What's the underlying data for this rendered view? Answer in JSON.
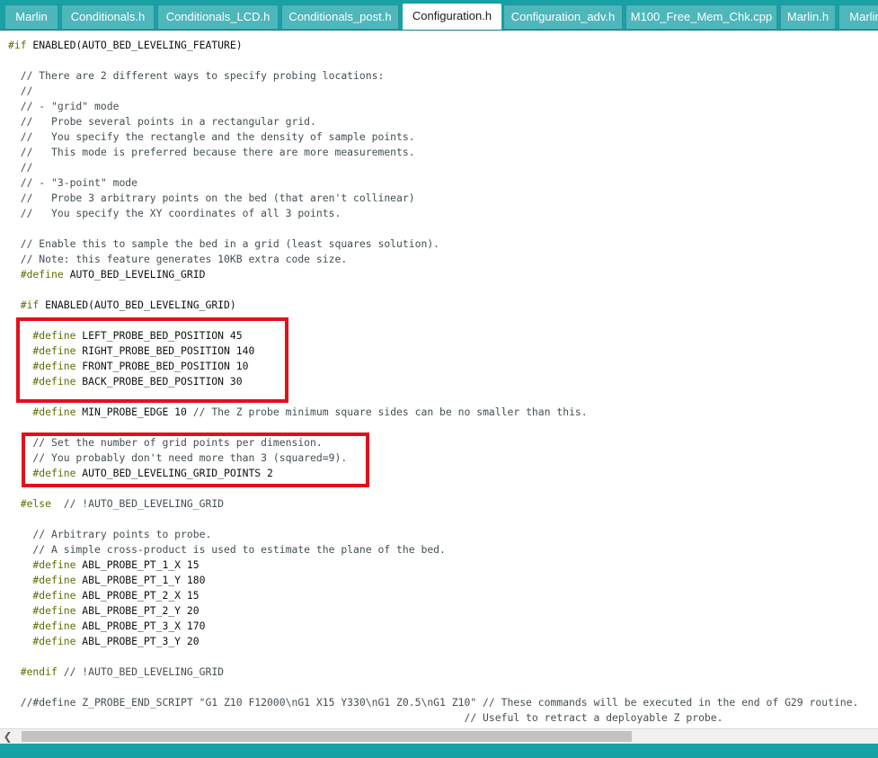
{
  "tabs": [
    {
      "label": "Marlin",
      "active": false
    },
    {
      "label": "Conditionals.h",
      "active": false
    },
    {
      "label": "Conditionals_LCD.h",
      "active": false
    },
    {
      "label": "Conditionals_post.h",
      "active": false
    },
    {
      "label": "Configuration.h",
      "active": true
    },
    {
      "label": "Configuration_adv.h",
      "active": false
    },
    {
      "label": "M100_Free_Mem_Chk.cpp",
      "active": false
    },
    {
      "label": "Marlin.h",
      "active": false
    },
    {
      "label": "Marlin",
      "active": false
    }
  ],
  "colors": {
    "accent": "#17a1a5",
    "preprocessor": "#5e6d03",
    "comment": "#434f54",
    "highlight": "#e3101b"
  },
  "icons": {
    "scroll_left": "chevron-left-icon"
  },
  "code_lines": [
    [
      {
        "k": "pp",
        "t": "#if"
      },
      {
        "k": "tx",
        "t": " ENABLED(AUTO_BED_LEVELING_FEATURE)"
      }
    ],
    [],
    [
      {
        "k": "cm",
        "t": "  // There are 2 different ways to specify probing locations:"
      }
    ],
    [
      {
        "k": "cm",
        "t": "  //"
      }
    ],
    [
      {
        "k": "cm",
        "t": "  // - \"grid\" mode"
      }
    ],
    [
      {
        "k": "cm",
        "t": "  //   Probe several points in a rectangular grid."
      }
    ],
    [
      {
        "k": "cm",
        "t": "  //   You specify the rectangle and the density of sample points."
      }
    ],
    [
      {
        "k": "cm",
        "t": "  //   This mode is preferred because there are more measurements."
      }
    ],
    [
      {
        "k": "cm",
        "t": "  //"
      }
    ],
    [
      {
        "k": "cm",
        "t": "  // - \"3-point\" mode"
      }
    ],
    [
      {
        "k": "cm",
        "t": "  //   Probe 3 arbitrary points on the bed (that aren't collinear)"
      }
    ],
    [
      {
        "k": "cm",
        "t": "  //   You specify the XY coordinates of all 3 points."
      }
    ],
    [],
    [
      {
        "k": "cm",
        "t": "  // Enable this to sample the bed in a grid (least squares solution)."
      }
    ],
    [
      {
        "k": "cm",
        "t": "  // Note: this feature generates 10KB extra code size."
      }
    ],
    [
      {
        "k": "pp",
        "t": "  #define"
      },
      {
        "k": "tx",
        "t": " AUTO_BED_LEVELING_GRID"
      }
    ],
    [],
    [
      {
        "k": "pp",
        "t": "  #if"
      },
      {
        "k": "tx",
        "t": " ENABLED(AUTO_BED_LEVELING_GRID)"
      }
    ],
    [],
    [
      {
        "k": "pp",
        "t": "    #define"
      },
      {
        "k": "tx",
        "t": " LEFT_PROBE_BED_POSITION 45"
      }
    ],
    [
      {
        "k": "pp",
        "t": "    #define"
      },
      {
        "k": "tx",
        "t": " RIGHT_PROBE_BED_POSITION 140"
      }
    ],
    [
      {
        "k": "pp",
        "t": "    #define"
      },
      {
        "k": "tx",
        "t": " FRONT_PROBE_BED_POSITION 10"
      }
    ],
    [
      {
        "k": "pp",
        "t": "    #define"
      },
      {
        "k": "tx",
        "t": " BACK_PROBE_BED_POSITION 30"
      }
    ],
    [],
    [
      {
        "k": "pp",
        "t": "    #define"
      },
      {
        "k": "tx",
        "t": " MIN_PROBE_EDGE 10 "
      },
      {
        "k": "cm",
        "t": "// The Z probe minimum square sides can be no smaller than this."
      }
    ],
    [],
    [
      {
        "k": "cm",
        "t": "    // Set the number of grid points per dimension."
      }
    ],
    [
      {
        "k": "cm",
        "t": "    // You probably don't need more than 3 (squared=9)."
      }
    ],
    [
      {
        "k": "pp",
        "t": "    #define"
      },
      {
        "k": "tx",
        "t": " AUTO_BED_LEVELING_GRID_POINTS 2"
      }
    ],
    [],
    [
      {
        "k": "pp",
        "t": "  #else"
      },
      {
        "k": "cm",
        "t": "  // !AUTO_BED_LEVELING_GRID"
      }
    ],
    [],
    [
      {
        "k": "cm",
        "t": "    // Arbitrary points to probe."
      }
    ],
    [
      {
        "k": "cm",
        "t": "    // A simple cross-product is used to estimate the plane of the bed."
      }
    ],
    [
      {
        "k": "pp",
        "t": "    #define"
      },
      {
        "k": "tx",
        "t": " ABL_PROBE_PT_1_X 15"
      }
    ],
    [
      {
        "k": "pp",
        "t": "    #define"
      },
      {
        "k": "tx",
        "t": " ABL_PROBE_PT_1_Y 180"
      }
    ],
    [
      {
        "k": "pp",
        "t": "    #define"
      },
      {
        "k": "tx",
        "t": " ABL_PROBE_PT_2_X 15"
      }
    ],
    [
      {
        "k": "pp",
        "t": "    #define"
      },
      {
        "k": "tx",
        "t": " ABL_PROBE_PT_2_Y 20"
      }
    ],
    [
      {
        "k": "pp",
        "t": "    #define"
      },
      {
        "k": "tx",
        "t": " ABL_PROBE_PT_3_X 170"
      }
    ],
    [
      {
        "k": "pp",
        "t": "    #define"
      },
      {
        "k": "tx",
        "t": " ABL_PROBE_PT_3_Y 20"
      }
    ],
    [],
    [
      {
        "k": "pp",
        "t": "  #endif"
      },
      {
        "k": "cm",
        "t": " // !AUTO_BED_LEVELING_GRID"
      }
    ],
    [],
    [
      {
        "k": "cm",
        "t": "  //#define Z_PROBE_END_SCRIPT \"G1 Z10 F12000\\nG1 X15 Y330\\nG1 Z0.5\\nG1 Z10\" // These commands will be executed in the end of G29 routine."
      }
    ],
    [
      {
        "k": "cm",
        "t": "                                                                          // Useful to retract a deployable Z probe."
      }
    ]
  ]
}
